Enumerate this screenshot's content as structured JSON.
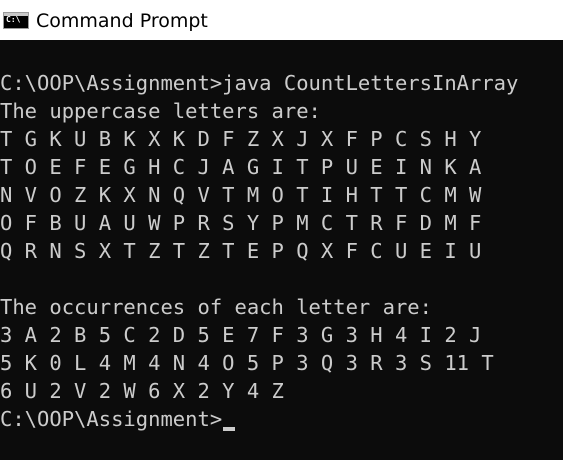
{
  "window": {
    "title": "Command Prompt",
    "icon": "C:\\"
  },
  "console": {
    "lines": [
      "",
      "C:\\OOP\\Assignment>java CountLettersInArray",
      "The uppercase letters are:",
      "T G K U B K X K D F Z X J X F P C S H Y",
      "T O E F E G H C J A G I T P U E I N K A",
      "N V O Z K X N Q V T M O T I H T T C M W",
      "O F B U A U W P R S Y P M C T R F D M F",
      "Q R N S X T Z T Z T E P Q X F C U E I U",
      "",
      "The occurrences of each letter are:",
      "3 A 2 B 5 C 2 D 5 E 7 F 3 G 3 H 4 I 2 J",
      "5 K 0 L 4 M 4 N 4 O 5 P 3 Q 3 R 3 S 11 T",
      "6 U 2 V 2 W 6 X 2 Y 4 Z"
    ],
    "prompt": "C:\\OOP\\Assignment>"
  },
  "colors": {
    "background": "#0c0c0c",
    "foreground": "#cccccc",
    "titlebar": "#ffffff"
  }
}
